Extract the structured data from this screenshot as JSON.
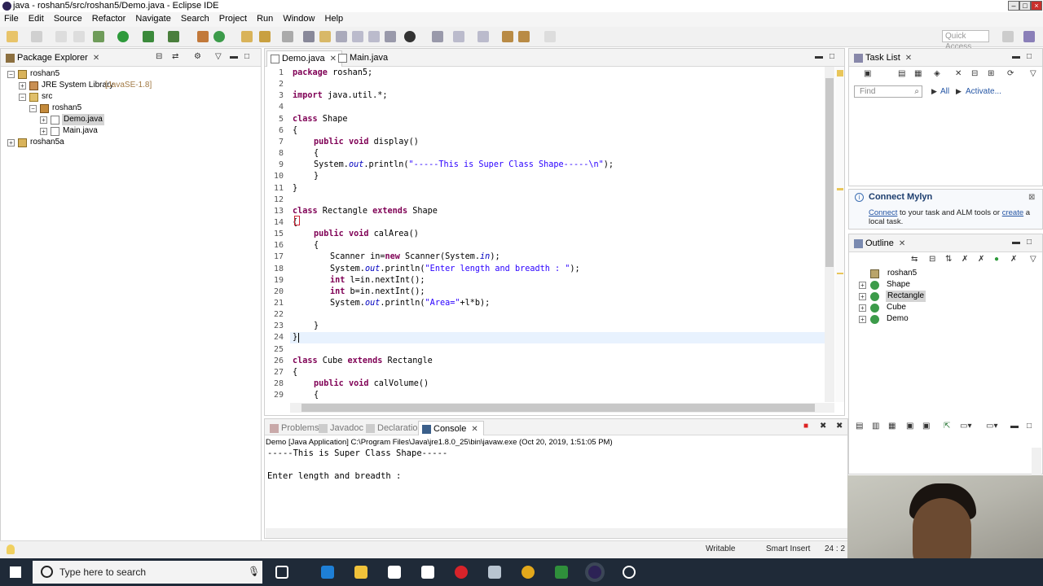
{
  "window": {
    "title": "java - roshan5/src/roshan5/Demo.java - Eclipse IDE"
  },
  "menu": [
    "File",
    "Edit",
    "Source",
    "Refactor",
    "Navigate",
    "Search",
    "Project",
    "Run",
    "Window",
    "Help"
  ],
  "toolbar": {
    "quick_access_placeholder": "Quick Access"
  },
  "package_explorer": {
    "title": "Package Explorer",
    "items": [
      {
        "label": "roshan5"
      },
      {
        "label": "JRE System Library",
        "suffix": "[JavaSE-1.8]"
      },
      {
        "label": "src"
      },
      {
        "label": "roshan5"
      },
      {
        "label": "Demo.java"
      },
      {
        "label": "Main.java"
      },
      {
        "label": "roshan5a"
      }
    ]
  },
  "editor": {
    "tabs": [
      {
        "label": "Demo.java"
      },
      {
        "label": "Main.java"
      }
    ],
    "line_numbers": [
      "1",
      "2",
      "3",
      "4",
      "5",
      "6",
      "7",
      "8",
      "9",
      "10",
      "11",
      "12",
      "13",
      "14",
      "15",
      "16",
      "17",
      "18",
      "19",
      "20",
      "21",
      "22",
      "23",
      "24",
      "25",
      "26",
      "27",
      "28",
      "29"
    ],
    "lines": {
      "l1": [
        "package",
        " roshan5;"
      ],
      "l3": [
        "import",
        " java.util.*;"
      ],
      "l5": [
        "class",
        " Shape"
      ],
      "l6": "{",
      "l7": [
        "public",
        " ",
        "void",
        " display()"
      ],
      "l8": "{",
      "l9": [
        "System.",
        "out",
        ".println(",
        "\"-----This is Super Class Shape-----\\n\"",
        ");"
      ],
      "l10": "}",
      "l11": "}",
      "l13": [
        "class",
        " Rectangle ",
        "extends",
        " Shape"
      ],
      "l14": "{",
      "l15": [
        "public",
        " ",
        "void",
        " calArea()"
      ],
      "l16": "{",
      "l17": [
        "Scanner ",
        "in",
        "=",
        "new",
        " Scanner(System.",
        "in",
        ");"
      ],
      "l18": [
        "System.",
        "out",
        ".println(",
        "\"Enter length and breadth : \"",
        ");"
      ],
      "l19": [
        "int",
        " l=in.nextInt();"
      ],
      "l20": [
        "int",
        " b=in.nextInt();"
      ],
      "l21": [
        "System.",
        "out",
        ".println(",
        "\"Area=\"",
        "+l*b);"
      ],
      "l23": "}",
      "l24": "}",
      "l26": [
        "class",
        " Cube ",
        "extends",
        " Rectangle"
      ],
      "l27": "{",
      "l28": [
        "public",
        " ",
        "void",
        " calVolume()"
      ],
      "l29": "{"
    }
  },
  "task_list": {
    "title": "Task List",
    "find_placeholder": "Find",
    "all_label": "All",
    "activate_label": "Activate..."
  },
  "mylyn": {
    "title": "Connect Mylyn",
    "connect_link": "Connect",
    "text_mid": " to your task and ALM tools or ",
    "create_link": "create",
    "text_end": " a local task."
  },
  "outline": {
    "title": "Outline",
    "items": [
      "roshan5",
      "Shape",
      "Rectangle",
      "Cube",
      "Demo"
    ]
  },
  "console": {
    "tabs": [
      "Problems",
      "Javadoc",
      "Declaration",
      "Console"
    ],
    "header": "Demo [Java Application] C:\\Program Files\\Java\\jre1.8.0_25\\bin\\javaw.exe (Oct 20, 2019, 1:51:05 PM)",
    "output": [
      "-----This is Super Class Shape-----",
      "",
      "Enter length and breadth :"
    ]
  },
  "status": {
    "writable": "Writable",
    "insert_mode": "Smart Insert",
    "position": "24 : 2"
  },
  "taskbar": {
    "search_placeholder": "Type here to search"
  }
}
